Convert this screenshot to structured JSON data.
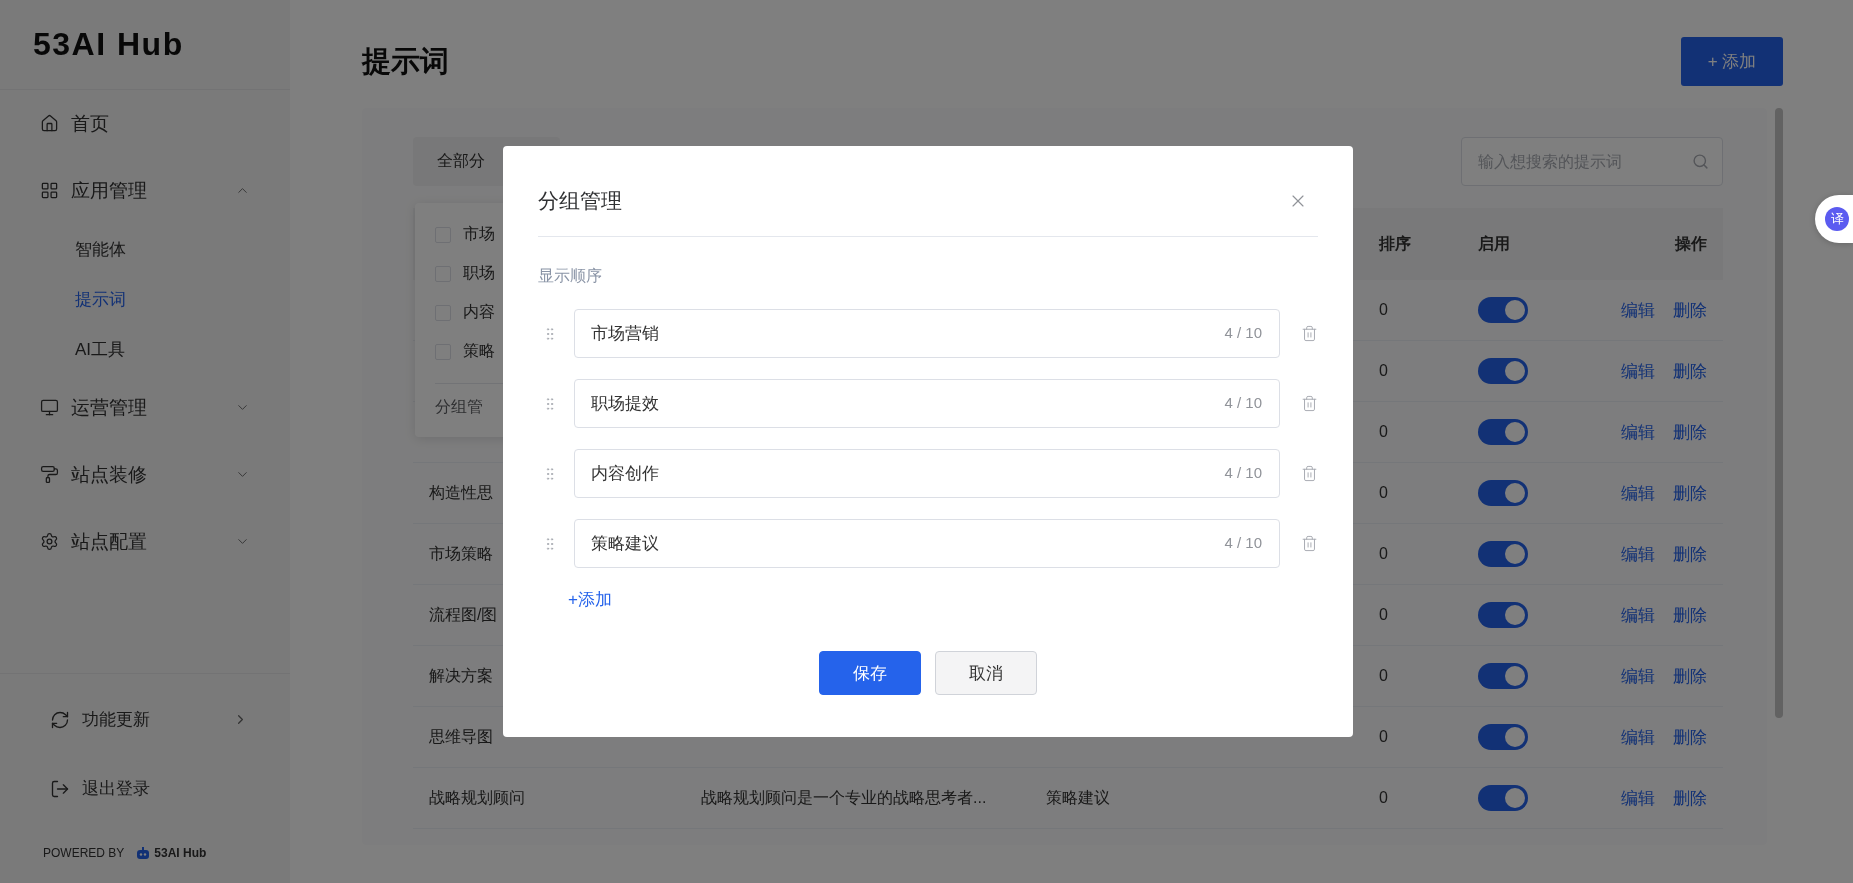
{
  "sidebar": {
    "logo": "53AI Hub",
    "items": [
      {
        "label": "首页",
        "selected": false
      },
      {
        "label": "应用管理",
        "selected": false,
        "expanded": true,
        "children": [
          {
            "label": "智能体",
            "selected": false
          },
          {
            "label": "提示词",
            "selected": true
          },
          {
            "label": "AI工具",
            "selected": false
          }
        ]
      },
      {
        "label": "运营管理",
        "selected": false,
        "expanded": false
      },
      {
        "label": "站点装修",
        "selected": false,
        "expanded": false
      },
      {
        "label": "站点配置",
        "selected": false,
        "expanded": false
      }
    ],
    "footer_items": [
      {
        "label": "功能更新"
      },
      {
        "label": "退出登录"
      }
    ],
    "powered_by": "POWERED BY",
    "powered_logo": "53AI Hub"
  },
  "page": {
    "title": "提示词",
    "add_button": "+ 添加"
  },
  "filter": {
    "label": "全部分"
  },
  "search": {
    "placeholder": "输入想搜索的提示词"
  },
  "table": {
    "columns": {
      "sort": "排序",
      "enabled": "启用",
      "actions": "操作"
    },
    "rows": [
      {
        "sort": "0",
        "enabled": true,
        "actions": [
          "编辑",
          "删除"
        ]
      },
      {
        "sort": "0",
        "enabled": true,
        "actions": [
          "编辑",
          "删除"
        ]
      },
      {
        "sort": "0",
        "enabled": true,
        "actions": [
          "编辑",
          "删除"
        ]
      },
      {
        "name": "构造性思",
        "sort": "0",
        "enabled": true,
        "actions": [
          "编辑",
          "删除"
        ]
      },
      {
        "name": "市场策略",
        "sort": "0",
        "enabled": true,
        "actions": [
          "编辑",
          "删除"
        ]
      },
      {
        "name": "流程图/图",
        "sort": "0",
        "enabled": true,
        "actions": [
          "编辑",
          "删除"
        ]
      },
      {
        "name": "解决方案",
        "sort": "0",
        "enabled": true,
        "actions": [
          "编辑",
          "删除"
        ]
      },
      {
        "name": "思维导图",
        "sort": "0",
        "enabled": true,
        "actions": [
          "编辑",
          "删除"
        ]
      },
      {
        "name": "战略规划顾问",
        "description": "战略规划顾问是一个专业的战略思考者...",
        "group": "策略建议",
        "sort": "0",
        "enabled": true,
        "actions": [
          "编辑",
          "删除"
        ]
      }
    ]
  },
  "group_menu": {
    "options": [
      {
        "label": "市场",
        "checked": false
      },
      {
        "label": "职场",
        "checked": false
      },
      {
        "label": "内容",
        "checked": false
      },
      {
        "label": "策略",
        "checked": false
      }
    ],
    "manage": "分组管"
  },
  "dialog": {
    "title": "分组管理",
    "section_label": "显示顺序",
    "groups": [
      {
        "value": "市场营销",
        "count": "4 / 10"
      },
      {
        "value": "职场提效",
        "count": "4 / 10"
      },
      {
        "value": "内容创作",
        "count": "4 / 10"
      },
      {
        "value": "策略建议",
        "count": "4 / 10"
      }
    ],
    "add_link": "+添加",
    "buttons": [
      {
        "label": "保存",
        "kind": "primary"
      },
      {
        "label": "取消",
        "kind": "default"
      }
    ]
  },
  "translator": {
    "label": "译"
  }
}
